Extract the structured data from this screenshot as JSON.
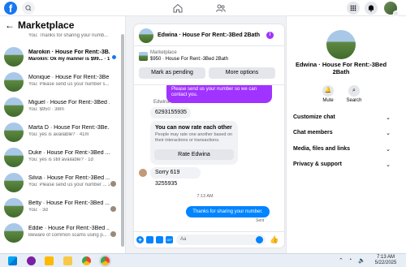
{
  "topbar": {
    "logo": "f",
    "search_icon": "search-icon",
    "home_icon": "home-icon",
    "friends_icon": "friends-icon",
    "menu_icon": "grid-menu-icon",
    "notif_icon": "bell-icon"
  },
  "sidebar": {
    "title": "Marketplace",
    "items": [
      {
        "name": "",
        "preview": "You: Thanks for sharing your numb... · 1m",
        "unread": false
      },
      {
        "name": "Marokin · House For Rent:-3B...",
        "preview": "Marokin: Ok my manner is $99... · 1m",
        "unread": true
      },
      {
        "name": "Monique · House For Rent:-3Be...",
        "preview": "You: Please send us your number s... 2m",
        "unread": false
      },
      {
        "name": "Miguel · House For Rent:-3Bed ...",
        "preview": "You: $950 · 38m",
        "unread": false
      },
      {
        "name": "Marta D · House For Rent:-3Be...",
        "preview": "You: yes is available? · 41m",
        "unread": false
      },
      {
        "name": "Duke · House For Rent:-3Bed ...",
        "preview": "You: yes is still available? · 1d",
        "unread": false
      },
      {
        "name": "Silvia · House For Rent:-3Bed ...",
        "preview": "You: Please send us your number ... 2d",
        "unread": false
      },
      {
        "name": "Betty · House For Rent:-3Bed ...",
        "preview": "You: · 3d",
        "unread": false
      },
      {
        "name": "Eddie · House For Rent:-3Bed ...",
        "preview": "Beware of common scams using p... · 3d",
        "unread": false
      }
    ]
  },
  "chat": {
    "title": "Edwina · House For Rent:-3Bed 2Bath",
    "marketplace_label": "Marketplace",
    "listing": "$950 · House For Rent:-3Bed 2Bath",
    "mark_pending": "Mark as pending",
    "more_options": "More options",
    "purple_msg": "Please send us your number so we can contact you.",
    "sender": "Edwina",
    "phone_msg": "6293155935",
    "rate_title": "You can now rate each other",
    "rate_desc": "People may rate one another based on their interactions or transactions.",
    "rate_button": "Rate Edwina",
    "sorry_msg": "Sorry 619 3255935",
    "timestamp": "7:13 AM",
    "my_msg": "Thanks for sharing your number.",
    "sent_label": "Sent",
    "input_placeholder": "Aa"
  },
  "right_panel": {
    "name": "Edwina · House For Rent:-3Bed 2Bath",
    "mute": "Mute",
    "search": "Search",
    "sections": [
      "Customize chat",
      "Chat members",
      "Media, files and links",
      "Privacy & support"
    ]
  },
  "taskbar": {
    "time": "7:13 AM",
    "date": "5/22/2025"
  },
  "colors": {
    "brand": "#1877f2",
    "accent_purple": "#a033ff",
    "my_bubble": "#0084ff"
  }
}
